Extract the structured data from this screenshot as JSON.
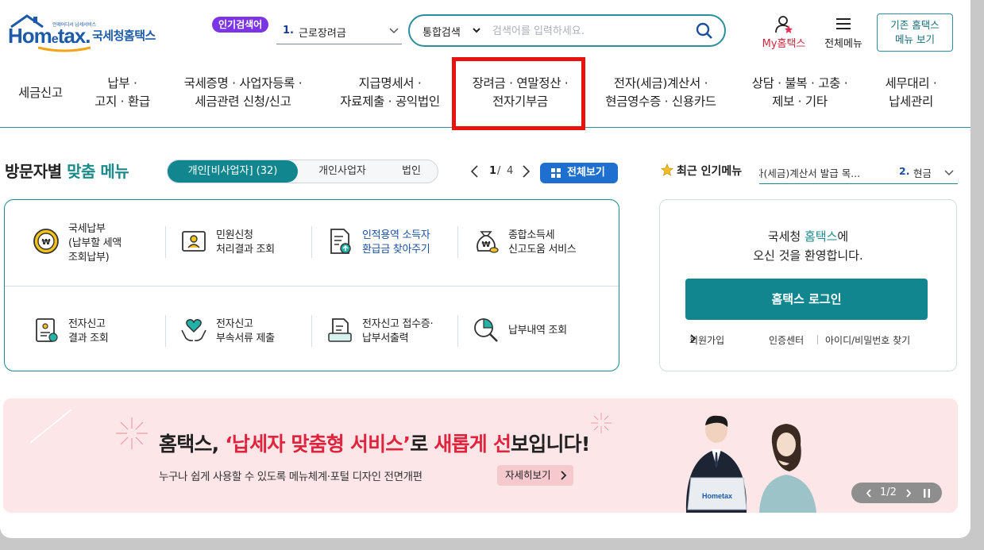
{
  "header": {
    "logo_small": "언제어디서 납세서비스",
    "logo_brand_1": "Hom",
    "logo_brand_e": "e",
    "logo_brand_2": "tax.",
    "logo_name": "국세청홈택스",
    "hot_badge": "인기검색어",
    "hot_keyword_rank": "1.",
    "hot_keyword": "근로장려금",
    "search_scope": "통합검색",
    "search_placeholder": "검색어를 입력하세요.",
    "my_label": "My홈택스",
    "all_menu_label": "전체메뉴",
    "old_site_line1": "기존 홈택스",
    "old_site_line2": "메뉴 보기"
  },
  "gnb": {
    "items": [
      {
        "l1": "세금신고",
        "l2": ""
      },
      {
        "l1": "납부 ·",
        "l2": "고지 · 환급"
      },
      {
        "l1": "국세증명 · 사업자등록 ·",
        "l2": "세금관련 신청/신고"
      },
      {
        "l1": "지급명세서 ·",
        "l2": "자료제출 · 공익법인"
      },
      {
        "l1": "장려금 · 연말정산 ·",
        "l2": "전자기부금"
      },
      {
        "l1": "전자(세금)계산서 ·",
        "l2": "현금영수증 · 신용카드"
      },
      {
        "l1": "상담 · 불복 · 고충 ·",
        "l2": "제보 · 기타"
      },
      {
        "l1": "세무대리 ·",
        "l2": "납세관리"
      }
    ]
  },
  "custom_menu": {
    "title_prefix": "방문자별",
    "title_highlight": "맞춤 메뉴",
    "tabs": [
      "개인[비사업자] (32)",
      "개인사업자",
      "법인"
    ],
    "page_current": "1",
    "page_sep": "/",
    "page_total": "4",
    "view_all": "전체보기",
    "services": [
      {
        "lines": [
          "국세납부",
          "(납부할 세액",
          "조회납부)"
        ],
        "icon": "won-coin-icon"
      },
      {
        "lines": [
          "민원신청",
          "처리결과 조회"
        ],
        "icon": "civil-document-icon"
      },
      {
        "lines": [
          "인적용역 소득자",
          "환급금 찾아주기"
        ],
        "icon": "refund-document-icon"
      },
      {
        "lines": [
          "종합소득세",
          "신고도움 서비스"
        ],
        "icon": "money-bag-icon"
      },
      {
        "lines": [
          "전자신고",
          "결과 조회"
        ],
        "icon": "report-result-icon"
      },
      {
        "lines": [
          "전자신고",
          "부속서류 제출"
        ],
        "icon": "heart-hands-icon"
      },
      {
        "lines": [
          "전자신고 접수증·",
          "납부서출력"
        ],
        "icon": "receipt-print-icon"
      },
      {
        "lines": [
          "납부내역 조회"
        ],
        "icon": "chart-search-icon"
      }
    ]
  },
  "popular": {
    "title": "최근 인기메뉴",
    "item1": "자(세금)계산서 발급 목...",
    "item2_rank": "2.",
    "item2": "현금"
  },
  "login": {
    "welcome_prefix": "국세청",
    "welcome_highlight": "홈택스",
    "welcome_suffix": "에",
    "welcome_line2": "오신 것을 환영합니다.",
    "button": "홈택스 로그인",
    "signup": "회원가입",
    "cert_center": "인증센터",
    "find_id": "아이디/비밀번호 찾기"
  },
  "banner": {
    "head_1": "홈택스, ",
    "head_2": "‘납세자 맞춤형 서비스’",
    "head_3": "로 ",
    "head_4": "새롭게 선",
    "head_5": "보입니다!",
    "sub": "누구나 쉽게 사용할 수 있도록 메뉴체계·포털 디자인 전면개편",
    "more": "자세히보기",
    "page": "1/2"
  },
  "colors": {
    "brand_blue": "#1d5aa8",
    "teal": "#12868f",
    "highlight_red": "#e8130f",
    "badge_purple": "#7b35e6",
    "banner_bg": "#fde6e8"
  }
}
